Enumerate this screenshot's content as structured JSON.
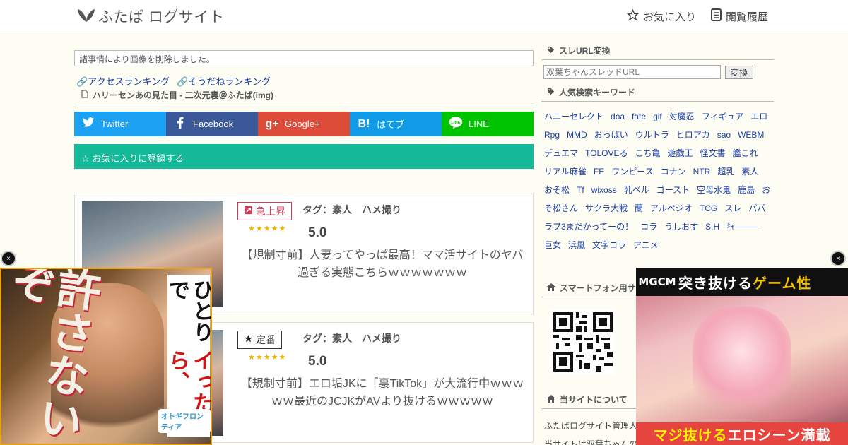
{
  "header": {
    "logo_text": "ふたば ログサイト",
    "favorites_label": "お気に入り",
    "history_label": "閲覧履歴"
  },
  "main": {
    "notice": "諸事情により画像を削除しました。",
    "rank_links": [
      "🔗アクセスランキング",
      "🔗そうだねランキング"
    ],
    "thread_title": "ハリーセンあの見た目 - 二次元裏＠ふたば(img)",
    "share": {
      "twitter": "Twitter",
      "facebook": "Facebook",
      "google": "Google+",
      "hatena": "はてブ",
      "line": "LINE"
    },
    "fav_register": "☆ お気に入りに登録する",
    "articles": [
      {
        "badge": "急上昇",
        "tag": "タグ：素人　ハメ撮り",
        "stars": "★★★★★",
        "score": "5.0",
        "title": "【規制寸前】人妻ってやっぱ最高！ママ活サイトのヤバ過ぎる実態こちらｗｗｗｗｗｗｗ"
      },
      {
        "badge": "定番",
        "tag": "タグ：素人　ハメ撮り",
        "stars": "★★★★★",
        "score": "5.0",
        "title": "【規制寸前】エロ垢JKに「裏TikTok」が大流行中ｗｗｗｗｗ最近のJCJKがAVより抜けるｗｗｗｗｗ"
      }
    ]
  },
  "sidebar": {
    "url_heading": "スレURL変換",
    "url_placeholder": "双葉ちゃんスレッドURL",
    "url_button": "変換",
    "keyword_heading": "人気検索キーワード",
    "keywords": [
      "ハニーセレクト",
      "doa",
      "fate",
      "gif",
      "対魔忍",
      "フィギュア",
      "エロRpg",
      "MMD",
      "おっぱい",
      "ウルトラ",
      "ヒロアカ",
      "sao",
      "WEBM",
      "デュエマ",
      "TOLOVEる",
      "こち亀",
      "遊戯王",
      "怪文書",
      "艦これ",
      "リアル麻雀",
      "FE",
      "ワンピース",
      "コナン",
      "NTR",
      "超乳",
      "素人",
      "おそ松",
      "Tf",
      "wixoss",
      "乳ベル",
      "ゴースト",
      "空母水鬼",
      "鹿島",
      "おそ松さん",
      "サクラ大戦",
      "蘭",
      "アルペジオ",
      "TCG",
      "スレ",
      "パパラブ3まだかってーの！",
      "コラ",
      "うしおす",
      "S.H",
      "ｷｬ────",
      "巨女",
      "浜風",
      "文字コラ",
      "アニメ"
    ],
    "smartphone_heading": "スマートフォン用サ",
    "about_heading": "当サイトについて",
    "about_line1": "ふたばログサイト管理人",
    "about_line2": "当サイトは双葉ちゃんの"
  },
  "ads": {
    "left": {
      "close": "×",
      "big_text": "許さないぞ",
      "v_text_1": "ひとりで",
      "v_text_2": "イったら、",
      "logo": "オトギフロンティア"
    },
    "right": {
      "close": "×",
      "brand": "MGCM",
      "top_text_1": "突き抜ける",
      "top_text_2": "ゲーム性",
      "bottom_text_1": "マジ抜ける",
      "bottom_text_2": "エロシーン満載"
    }
  },
  "colors": {
    "twitter": "#1da1f2",
    "facebook": "#3b5998",
    "google": "#dd4b39",
    "hatena": "#119ae5",
    "line": "#00c300",
    "fav_bar": "#14b99a",
    "link": "#1a3ea8"
  }
}
